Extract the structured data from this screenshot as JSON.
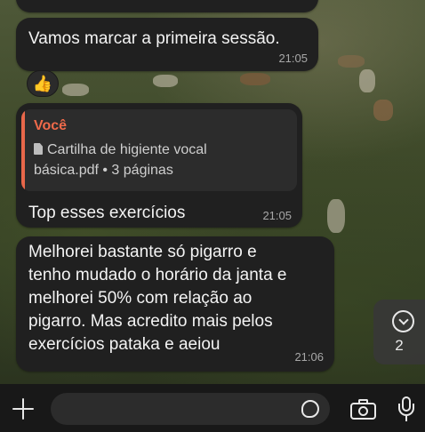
{
  "messages": [
    {
      "text": "Vamos marcar a primeira sessão.",
      "time": "21:05",
      "reaction": "👍"
    },
    {
      "reply_to": {
        "author": "Você",
        "document": "Cartilha de higiente vocal básica.pdf • 3 páginas"
      },
      "text": "Top esses exercícios",
      "time": "21:05"
    },
    {
      "text": "Melhorei bastante só pigarro  e\ntenho mudado o horário da janta e\nmelhorei 50% com relação ao\npigarro. Mas acredito mais pelos\nexercícios pataka e aeiou",
      "time": "21:06"
    }
  ],
  "scroll_indicator": {
    "unread_count": "2",
    "icon": "chevron-down-icon"
  },
  "composer": {
    "placeholder": "",
    "icons": [
      "plus-icon",
      "sticker-icon",
      "camera-icon",
      "microphone-icon"
    ]
  },
  "colors": {
    "bubble": "#202020",
    "quote_accent": "#f06a4a",
    "timestamp": "#a8a8a8"
  }
}
